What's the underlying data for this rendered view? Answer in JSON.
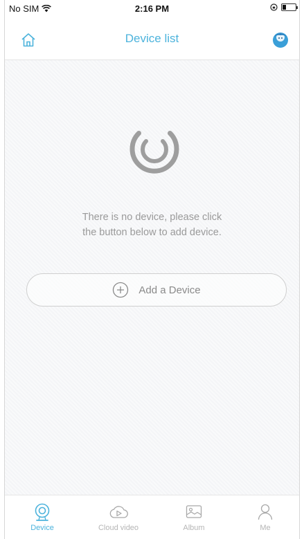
{
  "status_bar": {
    "carrier": "No SIM",
    "time": "2:16 PM"
  },
  "header": {
    "title": "Device list",
    "home_icon": "home-icon",
    "avatar_icon": "avatar-icon"
  },
  "empty_state": {
    "line1": "There is no device, please click",
    "line2": "the button below to add device."
  },
  "add_button": {
    "label": "Add a Device",
    "icon": "plus-circle-icon"
  },
  "tabs": [
    {
      "label": "Device",
      "icon": "camera-icon",
      "active": true
    },
    {
      "label": "Cloud video",
      "icon": "cloud-play-icon",
      "active": false
    },
    {
      "label": "Album",
      "icon": "photo-icon",
      "active": false
    },
    {
      "label": "Me",
      "icon": "user-icon",
      "active": false
    }
  ],
  "colors": {
    "accent": "#4cb3dc",
    "muted_text": "#9a9a9a",
    "inactive_tab": "#b5b5b5",
    "background": "#f4f5f7"
  }
}
